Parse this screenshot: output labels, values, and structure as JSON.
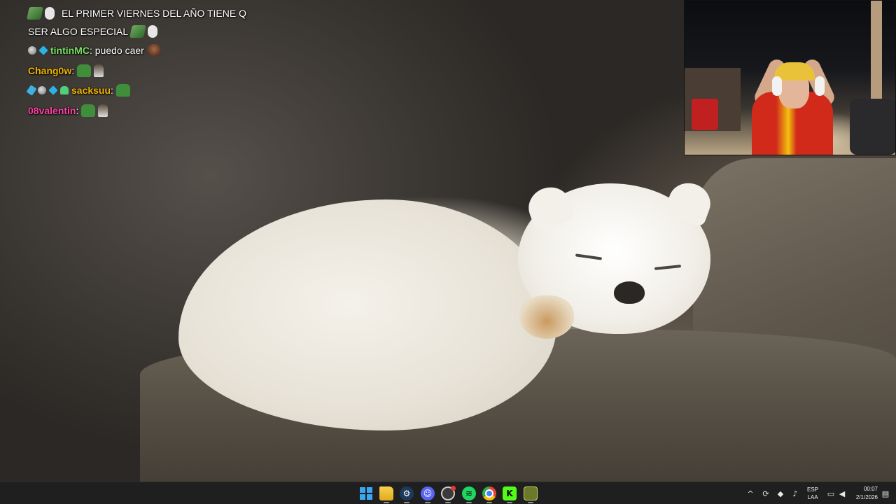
{
  "chat": {
    "messages": [
      {
        "user": "",
        "text": "EL PRIMER VIERNES DEL AÑO TIENE Q",
        "emotes": [
          "money-emote",
          "hands-emote"
        ]
      },
      {
        "user": "",
        "text": "SER ALGO ESPECIAL",
        "emotes": [
          "money-emote",
          "hands-emote"
        ]
      },
      {
        "user": "tintinMC",
        "user_color": "#7be063",
        "separator": ":",
        "text": " puedo caer",
        "badges": [
          "moon-badge",
          "cube-badge"
        ],
        "emotes": [
          "face-emote"
        ]
      },
      {
        "user": "Chang0w",
        "user_color": "#f0b400",
        "separator": ":",
        "text": "",
        "emotes": [
          "frog-emote",
          "smallguy-emote"
        ]
      },
      {
        "user": "sacksuu",
        "user_color": "#f0b400",
        "separator": ":",
        "text": "",
        "badges": [
          "sword-badge",
          "moon-badge",
          "cube-badge",
          "ghost-badge"
        ],
        "emotes": [
          "frog-emote"
        ]
      },
      {
        "user": "08valentin",
        "user_color": "#ff3fa4",
        "separator": ":",
        "text": "",
        "emotes": [
          "frog-emote",
          "smallguy-emote"
        ]
      }
    ]
  },
  "taskbar": {
    "apps": [
      {
        "name": "start-button",
        "icon": "windows-icon"
      },
      {
        "name": "file-explorer",
        "icon": "folder-icon"
      },
      {
        "name": "steam",
        "icon": "steam-icon"
      },
      {
        "name": "discord",
        "icon": "discord-icon"
      },
      {
        "name": "obs",
        "icon": "obs-icon"
      },
      {
        "name": "spotify",
        "icon": "spotify-icon"
      },
      {
        "name": "chrome",
        "icon": "chrome-icon"
      },
      {
        "name": "kick",
        "icon": "kick-icon",
        "glyph": "K"
      },
      {
        "name": "game",
        "icon": "game-icon"
      }
    ],
    "tray": {
      "chevron": "^",
      "language_line1": "ESP",
      "language_line2": "LAA",
      "time": "00:07",
      "date": "2/1/2026"
    }
  },
  "colors": {
    "taskbar_bg": "#1f1f1f",
    "windows_accent": "#3aa7f5",
    "kick_green": "#53fc18"
  }
}
